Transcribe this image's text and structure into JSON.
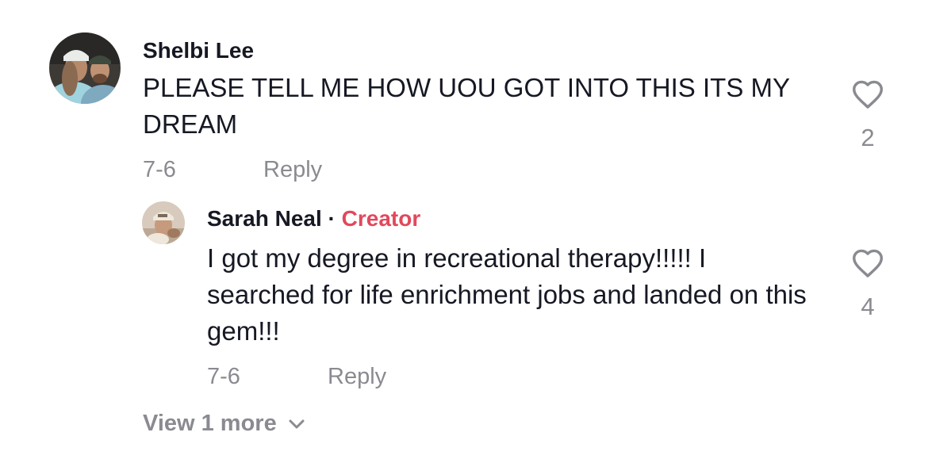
{
  "comments": [
    {
      "author": "Shelbi Lee",
      "text": "PLEASE TELL ME HOW UOU GOT INTO THIS ITS MY DREAM",
      "date": "7-6",
      "reply_label": "Reply",
      "likes": "2",
      "icon": "heart-outline-icon"
    }
  ],
  "replies": [
    {
      "author": "Sarah Neal",
      "separator": "·",
      "badge": "Creator",
      "text": "I got my degree in recreational therapy!!!!! I searched for life enrichment jobs and landed on this gem!!!",
      "date": "7-6",
      "reply_label": "Reply",
      "likes": "4",
      "icon": "heart-outline-icon"
    }
  ],
  "view_more": {
    "label": "View 1 more",
    "icon": "chevron-down-icon"
  },
  "colors": {
    "creator_badge": "#e2485c",
    "secondary_text": "#8a8b91",
    "primary_text": "#161823"
  }
}
